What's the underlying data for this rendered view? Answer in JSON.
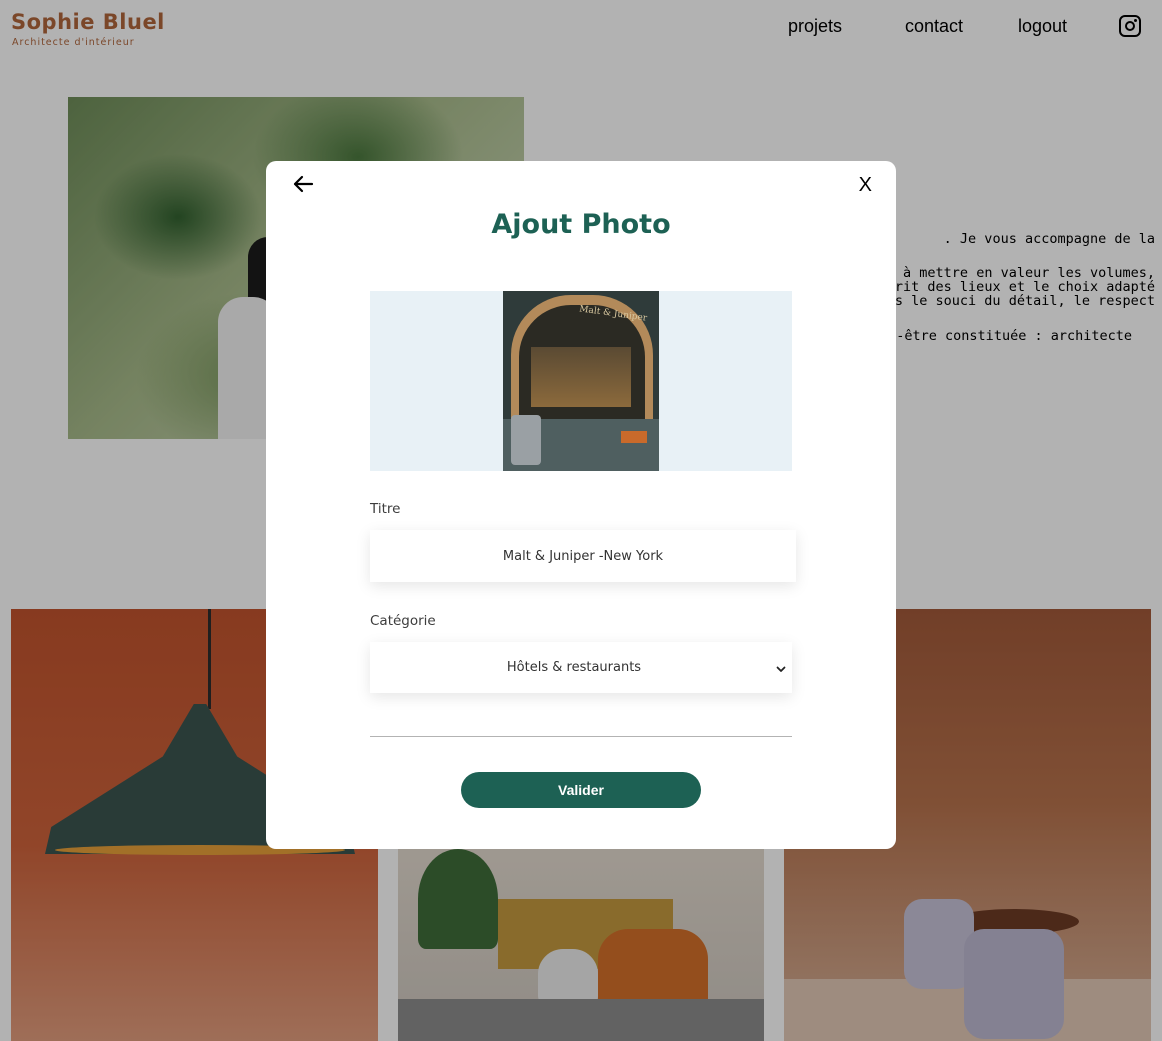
{
  "header": {
    "logo_name": "Sophie Bluel",
    "logo_subtitle": "Architecte d'intérieur",
    "nav": {
      "projets": "projets",
      "contact": "contact",
      "logout": "logout"
    },
    "social_icon": "instagram-icon"
  },
  "intro": {
    "bio_lines": [
      ". Je vous accompagne de la",
      "on à mettre en valeur les volumes,",
      "e l'esprit des lieux et le choix adapté",
      "é dans le souci du détail, le respect",
      "e peut-être constituée : architecte"
    ]
  },
  "modal": {
    "back_icon": "arrow-left-icon",
    "close_label": "X",
    "title": "Ajout Photo",
    "preview_sign": "Malt & Juniper",
    "titre_label": "Titre",
    "titre_value": "Malt & Juniper -New York",
    "categorie_label": "Catégorie",
    "categorie_value": "Hôtels & restaurants",
    "submit_label": "Valider"
  },
  "colors": {
    "brand": "#b1663c",
    "accent": "#1d6154",
    "upload_bg": "#e8f1f6",
    "overlay": "rgba(0,0,0,0.30)"
  }
}
